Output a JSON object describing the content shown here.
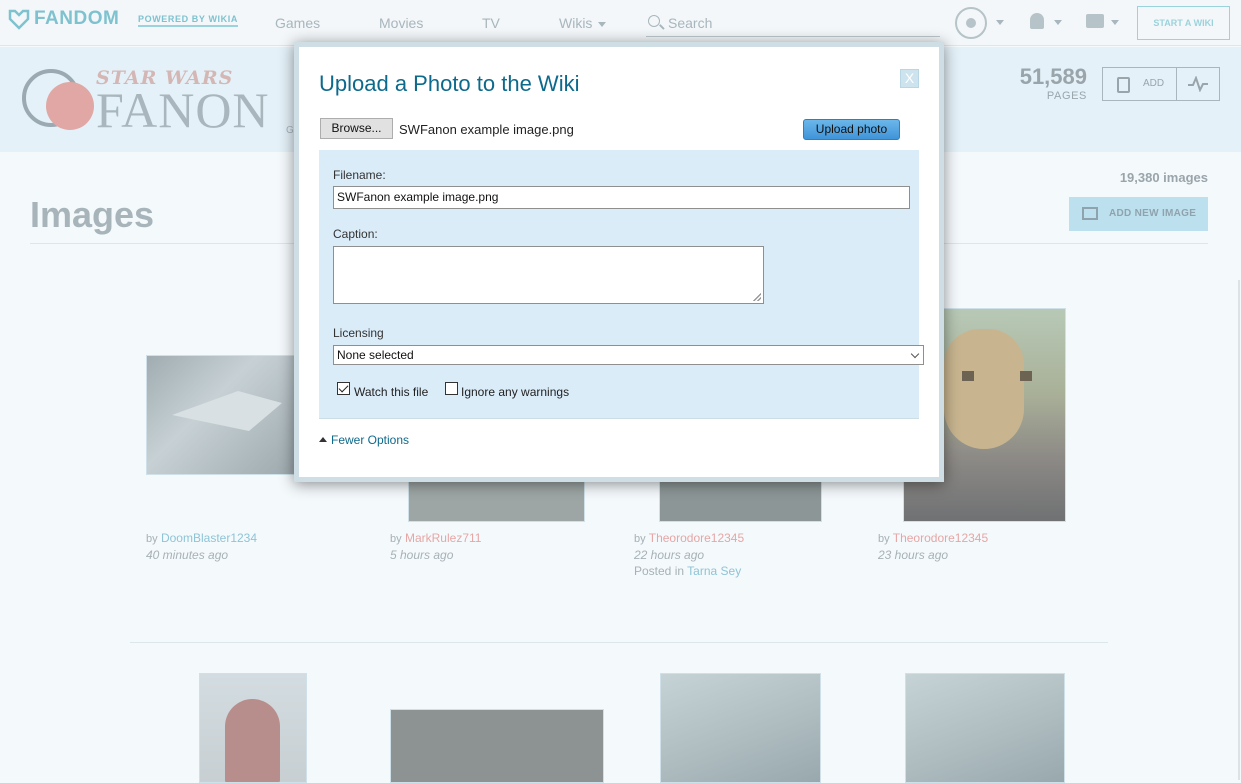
{
  "global_nav": {
    "brand": "FANDOM",
    "powered_by": "POWERED BY WIKIA",
    "links": [
      "Games",
      "Movies",
      "TV"
    ],
    "wikis_label": "Wikis",
    "search_placeholder": "Search",
    "start_wiki": "START A WIKI"
  },
  "wiki_header": {
    "wordmark_sub": "STAR WARS",
    "wordmark_main": "FANON",
    "wordmark_cut": "GI",
    "page_count": "51,589",
    "page_count_label": "PAGES",
    "add_label": "ADD"
  },
  "page": {
    "title": "Images",
    "image_count": "19,380 images",
    "add_new_image": "ADD NEW IMAGE"
  },
  "images": [
    {
      "by": "by",
      "user": "DoomBlaster1234",
      "time": "40 minutes ago"
    },
    {
      "by": "by",
      "user": "MarkRulez711",
      "time": "5 hours ago"
    },
    {
      "by": "by",
      "user": "Theorodore12345",
      "time": "22 hours ago",
      "posted_in_label": "Posted in",
      "posted_in": "Tarna Sey"
    },
    {
      "by": "by",
      "user": "Theorodore12345",
      "time": "23 hours ago"
    }
  ],
  "modal": {
    "title": "Upload a Photo to the Wiki",
    "close": "X",
    "browse": "Browse...",
    "selected_file": "SWFanon example image.png",
    "upload_button": "Upload photo",
    "filename_label": "Filename:",
    "filename_value": "SWFanon example image.png",
    "caption_label": "Caption:",
    "caption_value": "",
    "licensing_label": "Licensing",
    "licensing_value": "None selected",
    "watch_label": "Watch this file",
    "watch_checked": true,
    "ignore_label": "Ignore any warnings",
    "ignore_checked": false,
    "fewer_options": "Fewer Options"
  }
}
